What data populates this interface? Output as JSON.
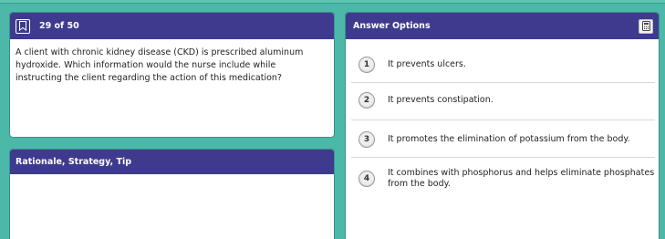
{
  "question": {
    "counter": "29 of 50",
    "text": "A client with chronic kidney disease (CKD) is prescribed aluminum hydroxide. Which information would the nurse include while instructing the client regarding the action of this medication?"
  },
  "rationale": {
    "title": "Rationale, Strategy, Tip"
  },
  "answers": {
    "title": "Answer Options",
    "options": [
      {
        "number": "1",
        "text": "It prevents ulcers."
      },
      {
        "number": "2",
        "text": "It prevents constipation."
      },
      {
        "number": "3",
        "text": "It promotes the elimination of potassium from the body."
      },
      {
        "number": "4",
        "text": "It combines with phosphorus and helps eliminate phosphates from the body."
      }
    ]
  },
  "icons": {
    "bookmark": "bookmark-icon",
    "calculator": "calculator-icon"
  },
  "colors": {
    "background": "#4bb8a9",
    "header": "#3e3b8e",
    "panel": "#ffffff"
  }
}
